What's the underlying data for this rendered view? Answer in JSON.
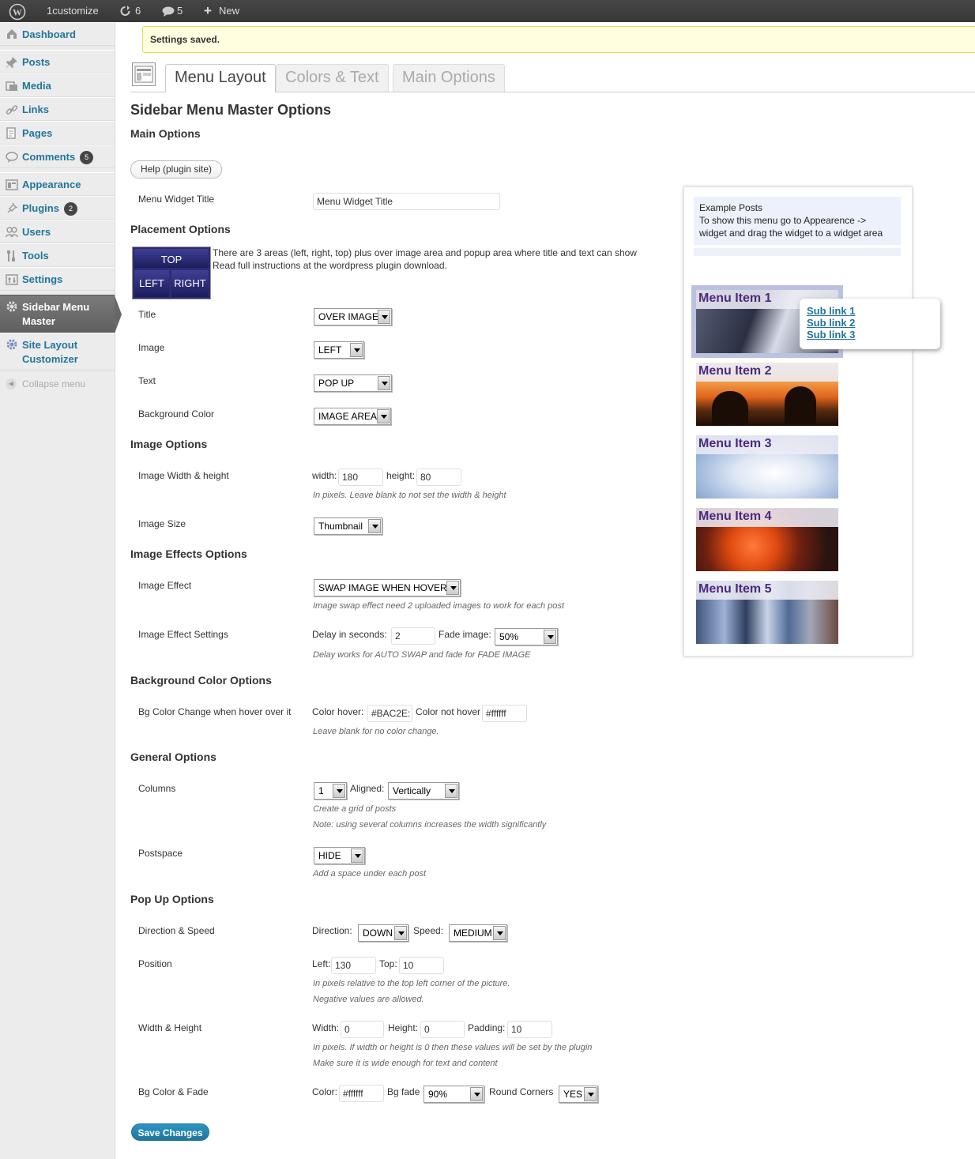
{
  "adminbar": {
    "site_name": "1customize",
    "updates_count": "6",
    "comments_count": "5",
    "new_label": "New"
  },
  "menu": {
    "dashboard": "Dashboard",
    "posts": "Posts",
    "media": "Media",
    "links": "Links",
    "pages": "Pages",
    "comments": "Comments",
    "comments_count": "5",
    "appearance": "Appearance",
    "plugins": "Plugins",
    "plugins_count": "2",
    "users": "Users",
    "tools": "Tools",
    "settings": "Settings",
    "sidebar_line1": "Sidebar Menu",
    "sidebar_line2": "Master",
    "site_layout_line1": "Site Layout",
    "site_layout_line2": "Customizer",
    "collapse": "Collapse menu"
  },
  "notice": "Settings saved.",
  "tabs": {
    "menu_layout": "Menu Layout",
    "colors_text": "Colors & Text",
    "main_options": "Main Options"
  },
  "page_title": "Sidebar Menu Master Options",
  "sections": {
    "main": "Main Options",
    "placement": "Placement Options",
    "image": "Image Options",
    "effects": "Image Effects Options",
    "bg": "Background Color Options",
    "general": "General Options",
    "popup": "Pop Up Options"
  },
  "help_button": "Help (plugin site)",
  "main": {
    "widget_title_label": "Menu Widget Title",
    "widget_title_value": "Menu Widget Title"
  },
  "placement": {
    "img_top": "TOP",
    "img_left": "LEFT",
    "img_right": "RIGHT",
    "desc1": "There are 3 areas (left, right, top) plus over image area and popup area where title and text can show",
    "desc2": "Read full instructions at the wordpress plugin download.",
    "title_label": "Title",
    "title_value": "OVER IMAGE",
    "image_label": "Image",
    "image_value": "LEFT",
    "text_label": "Text",
    "text_value": "POP UP",
    "bgcolor_label": "Background Color",
    "bgcolor_value": "IMAGE AREA"
  },
  "image": {
    "wh_label": "Image Width & height",
    "width_label": "width:",
    "width_value": "180",
    "height_label": "height:",
    "height_value": "80",
    "wh_note": "In pixels. Leave blank to not set the width & height",
    "size_label": "Image Size",
    "size_value": "Thumbnail"
  },
  "effects": {
    "effect_label": "Image Effect",
    "effect_value": "SWAP IMAGE WHEN HOVER",
    "effect_note": "Image swap effect need 2 uploaded images to work for each post",
    "settings_label": "Image Effect Settings",
    "delay_label": "Delay in seconds:",
    "delay_value": "2",
    "fade_label": "Fade image:",
    "fade_value": "50%",
    "settings_note": "Delay works for AUTO SWAP and fade for FADE IMAGE"
  },
  "bg": {
    "change_label": "Bg Color Change when hover over it",
    "hover_label": "Color hover:",
    "hover_value": "#BAC2E:",
    "nothover_label": "Color not hover",
    "nothover_value": "#ffffff",
    "note": "Leave blank for no color change."
  },
  "general": {
    "columns_label": "Columns",
    "columns_value": "1",
    "aligned_label": "Aligned:",
    "aligned_value": "Vertically",
    "note1": "Create a grid of posts",
    "note2": "Note: using several columns increases the width significantly",
    "postspace_label": "Postspace",
    "postspace_value": "HIDE",
    "postspace_note": "Add a space under each post"
  },
  "popup": {
    "dir_label": "Direction & Speed",
    "direction_label": "Direction:",
    "direction_value": "DOWN",
    "speed_label": "Speed:",
    "speed_value": "MEDIUM",
    "position_label": "Position",
    "left_label": "Left:",
    "left_value": "130",
    "top_label": "Top:",
    "top_value": "10",
    "pos_note1": "In pixels relative to the top left corner of the picture.",
    "pos_note2": "Negative values are allowed.",
    "wh_label": "Width & Height",
    "width_label": "Width:",
    "width_value": "0",
    "height_label": "Height:",
    "height_value": "0",
    "padding_label": "Padding:",
    "padding_value": "10",
    "wh_note1": "In pixels. If width or height is 0 then these values will be set by the plugin",
    "wh_note2": "Make sure it is wide enough for text and content",
    "bgfade_label": "Bg Color & Fade",
    "color_label": "Color:",
    "color_value": "#ffffff",
    "fade_label": "Bg fade",
    "fade_value": "90%",
    "round_label": "Round Corners",
    "round_value": "YES"
  },
  "save_button": "Save Changes",
  "preview": {
    "header_line1": "Example Posts",
    "header_line2": "To show this menu go to Appearence ->",
    "header_line3": "widget and drag the widget to a widget area",
    "items": [
      "Menu Item 1",
      "Menu Item 2",
      "Menu Item 3",
      "Menu Item 4",
      "Menu Item 5"
    ],
    "sub_links": [
      "Sub link 1",
      "Sub link 2",
      "Sub link 3"
    ],
    "active_bg": "#BAC2E0"
  }
}
